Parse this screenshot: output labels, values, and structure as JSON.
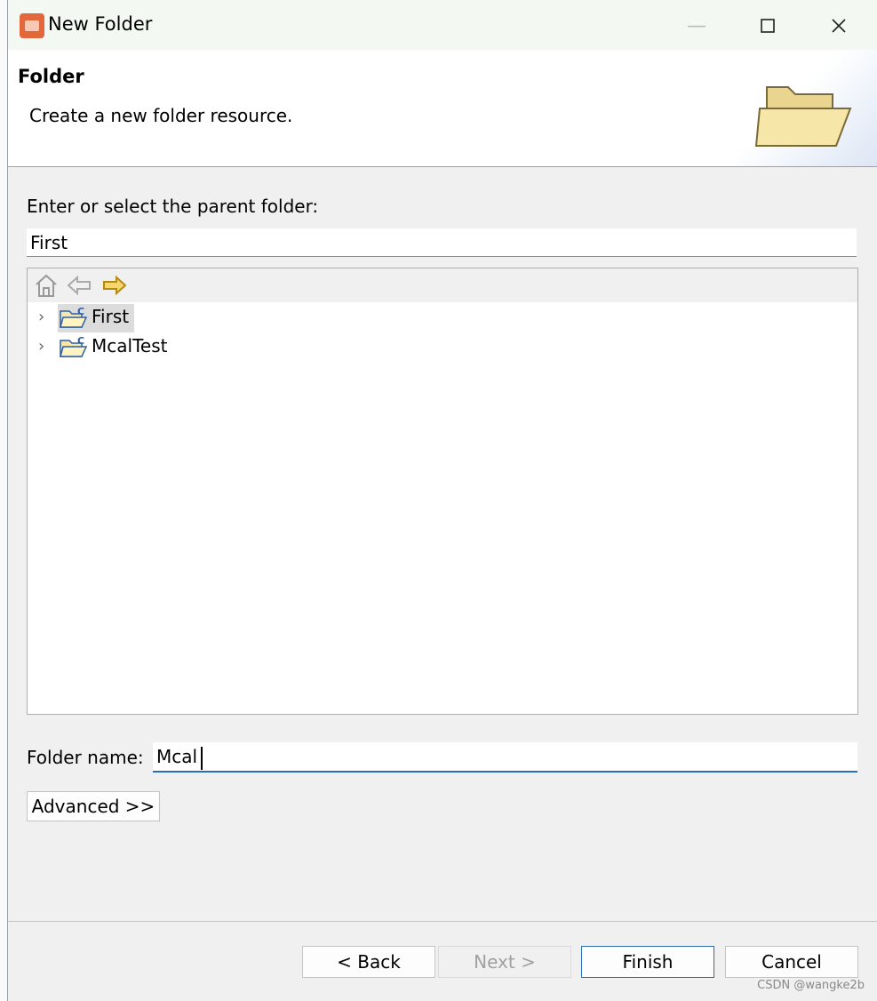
{
  "window": {
    "title": "New Folder",
    "app_icon": "eclipse-app-icon",
    "controls": [
      "minimize-icon",
      "maximize-icon",
      "close-icon"
    ]
  },
  "banner": {
    "title": "Folder",
    "description": "Create a new folder resource.",
    "icon": "open-folder-icon"
  },
  "parent": {
    "label": "Enter or select the parent folder:",
    "value": "First"
  },
  "tree": {
    "toolbar": [
      "home-icon",
      "back-arrow-icon",
      "forward-arrow-icon"
    ],
    "items": [
      {
        "label": "First",
        "selected": true,
        "icon": "c-project-folder-icon"
      },
      {
        "label": "McalTest",
        "selected": false,
        "icon": "c-project-folder-icon"
      }
    ]
  },
  "folder_name": {
    "label": "Folder name:",
    "value": "Mcal"
  },
  "buttons": {
    "advanced": "Advanced >>",
    "back": "< Back",
    "next": "Next >",
    "finish": "Finish",
    "cancel": "Cancel"
  },
  "watermark": "CSDN @wangke2b"
}
